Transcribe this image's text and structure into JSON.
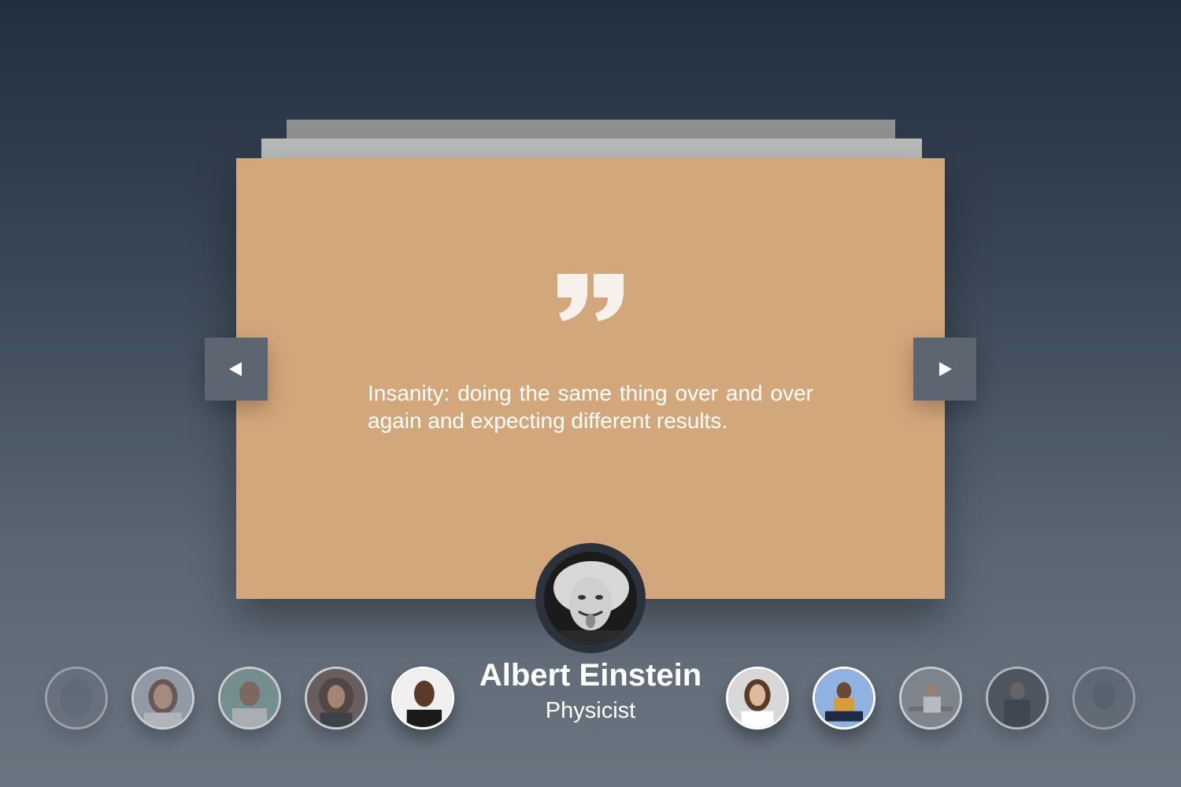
{
  "quote": {
    "text": "Insanity: doing the same thing over and over again and expecting different results.",
    "mark_icon": "quote-icon"
  },
  "person": {
    "name": "Albert Einstein",
    "title": "Physicist"
  },
  "navigation": {
    "prev_icon": "triangle-left-icon",
    "next_icon": "triangle-right-icon"
  },
  "colors": {
    "card": "#d3a77c",
    "nav_button": "#5d6670",
    "text": "#ffffff"
  },
  "thumbnails": [
    {
      "name": "person-1",
      "state": "faded"
    },
    {
      "name": "person-2",
      "state": "dimmed"
    },
    {
      "name": "person-3",
      "state": "dimmed"
    },
    {
      "name": "person-4",
      "state": "dimmed"
    },
    {
      "name": "person-5",
      "state": "active-neighbor"
    },
    {
      "name": "person-6",
      "state": "active-neighbor"
    },
    {
      "name": "person-7",
      "state": "active-neighbor"
    },
    {
      "name": "person-8",
      "state": "dimmed"
    },
    {
      "name": "person-9",
      "state": "dimmed"
    },
    {
      "name": "person-10",
      "state": "faded"
    }
  ]
}
